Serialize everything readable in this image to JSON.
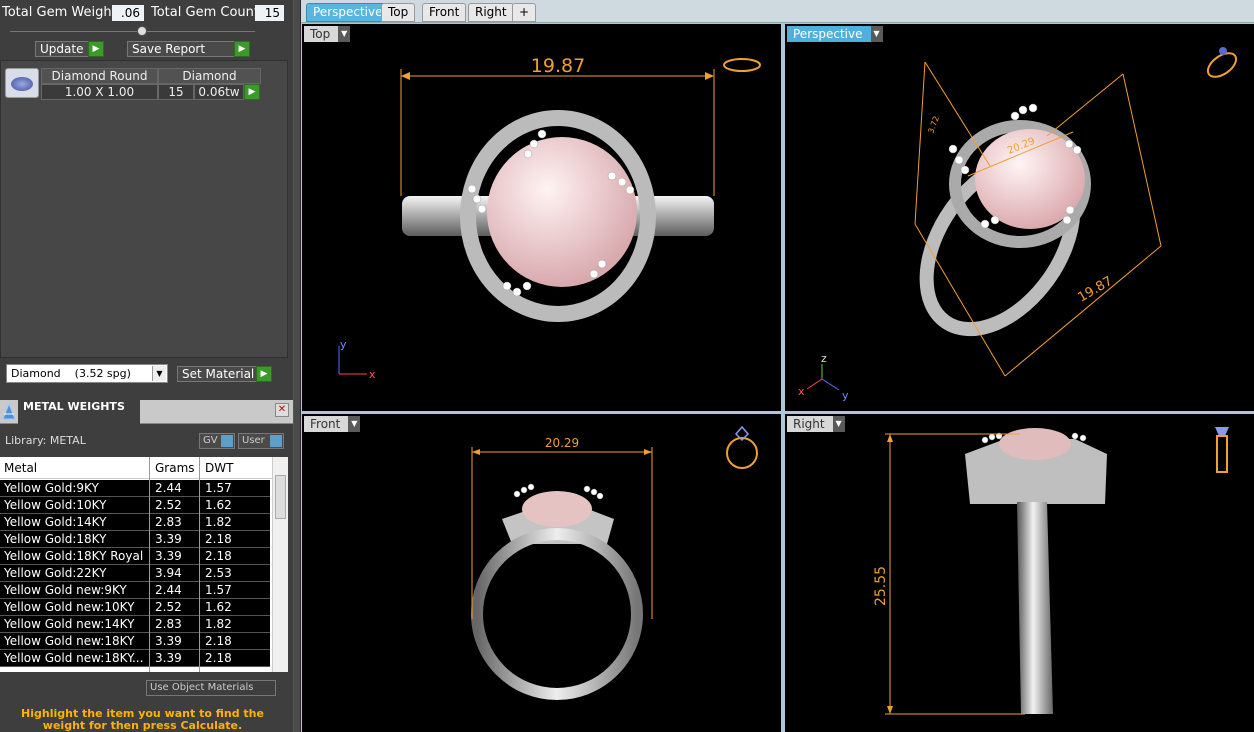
{
  "stats": {
    "gem_weight_label": "Total Gem Weight",
    "gem_weight_value": ".06",
    "gem_count_label": "Total Gem Count",
    "gem_count_value": "15"
  },
  "actions": {
    "update_label": "Update",
    "save_report_label": "Save Report"
  },
  "gem": {
    "col_shape": "Diamond Round",
    "col_type": "Diamond",
    "size": "1.00 X 1.00",
    "count": "15",
    "weight": "0.06tw"
  },
  "material": {
    "selected": "Diamond    (3.52 spg)",
    "set_label": "Set Material"
  },
  "metal_weights": {
    "title": "METAL WEIGHTS",
    "library_label": "Library: METAL",
    "gv_label": "GV",
    "user_label": "User",
    "columns": [
      "Metal",
      "Grams",
      "DWT"
    ],
    "rows": [
      {
        "metal": "Yellow Gold:9KY",
        "grams": "2.44",
        "dwt": "1.57"
      },
      {
        "metal": "Yellow Gold:10KY",
        "grams": "2.52",
        "dwt": "1.62"
      },
      {
        "metal": "Yellow Gold:14KY",
        "grams": "2.83",
        "dwt": "1.82"
      },
      {
        "metal": "Yellow Gold:18KY",
        "grams": "3.39",
        "dwt": "2.18"
      },
      {
        "metal": "Yellow Gold:18KY Royal",
        "grams": "3.39",
        "dwt": "2.18"
      },
      {
        "metal": "Yellow Gold:22KY",
        "grams": "3.94",
        "dwt": "2.53"
      },
      {
        "metal": "Yellow Gold new:9KY",
        "grams": "2.44",
        "dwt": "1.57"
      },
      {
        "metal": "Yellow Gold new:10KY",
        "grams": "2.52",
        "dwt": "1.62"
      },
      {
        "metal": "Yellow Gold new:14KY",
        "grams": "2.83",
        "dwt": "1.82"
      },
      {
        "metal": "Yellow Gold new:18KY",
        "grams": "3.39",
        "dwt": "2.18"
      },
      {
        "metal": "Yellow Gold new:18KY...",
        "grams": "3.39",
        "dwt": "2.18"
      }
    ],
    "use_object_materials": "Use Object Materials",
    "hint": "Highlight the item you want to find the weight for then press Calculate."
  },
  "view_tabs": [
    "Perspective",
    "Top",
    "Front",
    "Right",
    "+"
  ],
  "viewports": {
    "top": {
      "label": "Top",
      "dimension": "19.87",
      "axis_y": "y",
      "axis_x": "x"
    },
    "perspective": {
      "label": "Perspective",
      "dimension_a": "19.87",
      "dimension_b": "20.29",
      "dimension_c": "3.72",
      "axis_z": "z",
      "axis_x": "x",
      "axis_y": "y"
    },
    "front": {
      "label": "Front",
      "dimension": "20.29"
    },
    "right": {
      "label": "Right",
      "dimension": "25.55"
    }
  },
  "colors": {
    "dimension": "#f0a030",
    "accent": "#4fb0de",
    "go_button": "#3c9a2c",
    "hint": "#ffb300"
  }
}
